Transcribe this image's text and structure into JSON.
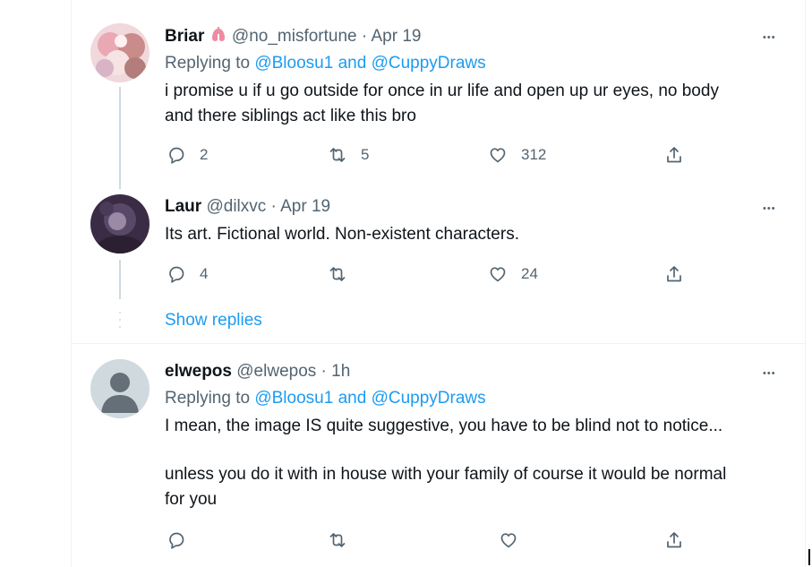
{
  "tweets": [
    {
      "name": "Briar",
      "handle": "@no_misfortune",
      "sep": "·",
      "time": "Apr 19",
      "replying_prefix": "Replying to",
      "mention1": "@Bloosu1",
      "and": "and",
      "mention2": "@CuppyDraws",
      "text_line1": "i promise u if u go outside for once in ur life and open up ur eyes, no body",
      "text_line2": "and there siblings act like this bro",
      "replies": "2",
      "retweets": "5",
      "likes": "312",
      "more": "•••"
    },
    {
      "name": "Laur",
      "handle": "@dilxvc",
      "sep": "·",
      "time": "Apr 19",
      "text_line1": "Its art. Fictional world. Non-existent characters.",
      "replies": "4",
      "retweets": "",
      "likes": "24",
      "more": "•••"
    },
    {
      "name": "elwepos",
      "handle": "@elwepos",
      "sep": "·",
      "time": "1h",
      "replying_prefix": "Replying to",
      "mention1": "@Bloosu1",
      "and": "and",
      "mention2": "@CuppyDraws",
      "text_line1": "I mean, the image IS quite suggestive, you have to be blind not to notice...",
      "text_line2": "unless you do it with in house with  your family of course it would be normal",
      "text_line3": "for you",
      "replies": "",
      "retweets": "",
      "likes": "",
      "more": "•••"
    }
  ],
  "show_replies": "Show replies",
  "icons": {
    "reply": "speech-bubble-icon",
    "retweet": "retweet-icon",
    "like": "heart-icon",
    "share": "share-upload-icon"
  },
  "colors": {
    "link": "#1d9bf0",
    "secondary": "#536471",
    "primary": "#0f1419"
  }
}
